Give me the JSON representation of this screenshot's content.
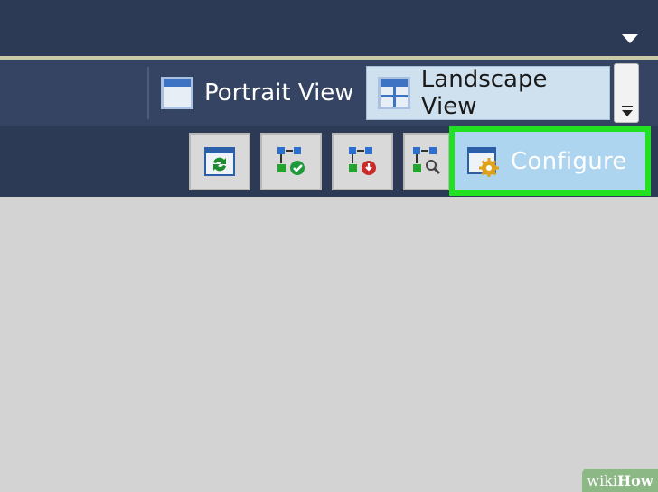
{
  "views": {
    "portrait_label": "Portrait View",
    "landscape_label": "Landscape View",
    "selected": "landscape"
  },
  "toolbar": {
    "configure_label": "Configure",
    "tools": [
      {
        "icon": "refresh-window-icon"
      },
      {
        "icon": "approve-hierarchy-icon"
      },
      {
        "icon": "reject-hierarchy-icon"
      },
      {
        "icon": "search-hierarchy-icon"
      }
    ]
  },
  "colors": {
    "highlight": "#22e022",
    "title_bar": "#2d3a55",
    "selected_tab": "#cfe1ef"
  },
  "watermark": {
    "prefix": "wiki",
    "suffix": "How"
  }
}
